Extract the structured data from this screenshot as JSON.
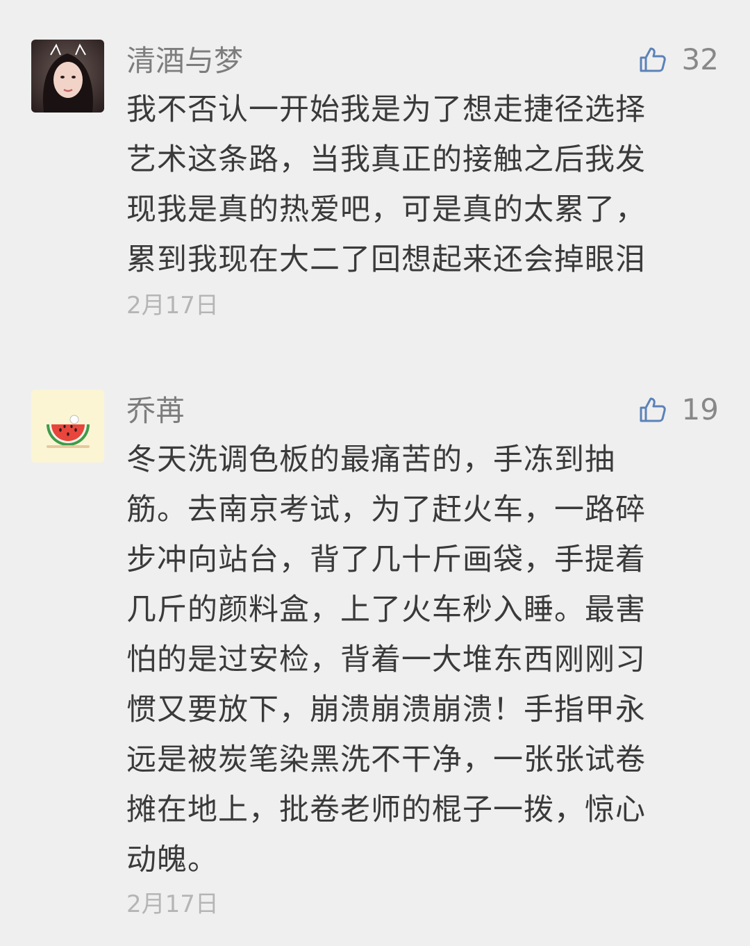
{
  "comments": [
    {
      "nickname": "清酒与梦",
      "likes": "32",
      "lines": [
        "我不否认一开始我是为了想走捷径选择",
        "艺术这条路，当我真正的接触之后我发",
        "现我是真的热爱吧，可是真的太累了，",
        "累到我现在大二了回想起来还会掉眼泪"
      ],
      "date": "2月17日"
    },
    {
      "nickname": "乔苒",
      "likes": "19",
      "lines": [
        "冬天洗调色板的最痛苦的，手冻到抽",
        "筋。去南京考试，为了赶火车，一路碎",
        "步冲向站台，背了几十斤画袋，手提着",
        "几斤的颜料盒，上了火车秒入睡。最害",
        "怕的是过安检，背着一大堆东西刚刚习",
        "惯又要放下，崩溃崩溃崩溃！手指甲永",
        "远是被炭笔染黑洗不干净，一张张试卷",
        "摊在地上，批卷老师的棍子一拨，惊心",
        "动魄。"
      ],
      "date": "2月17日"
    }
  ],
  "icons": {
    "like": "thumbs-up-icon"
  },
  "colors": {
    "background": "#efefef",
    "like_icon": "#5b82b8",
    "nickname": "#7d7d7d",
    "content": "#3a3a3a",
    "date": "#b5b5b5"
  }
}
